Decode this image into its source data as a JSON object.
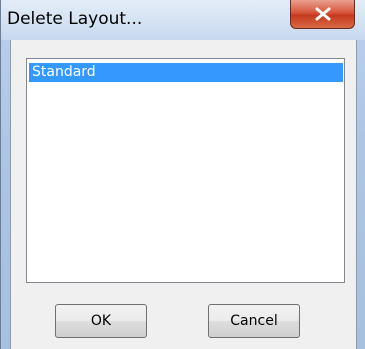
{
  "window": {
    "title": "Delete Layout..."
  },
  "titlebar": {
    "close_icon": "close-x-icon"
  },
  "layout_list": {
    "items": [
      {
        "label": "Standard",
        "selected": true
      }
    ]
  },
  "buttons": {
    "ok_label": "OK",
    "cancel_label": "Cancel"
  },
  "colors": {
    "selection": "#3399ff",
    "close_button": "#c53a1f",
    "frame": "#aec6e3",
    "client": "#f0f0f0"
  }
}
